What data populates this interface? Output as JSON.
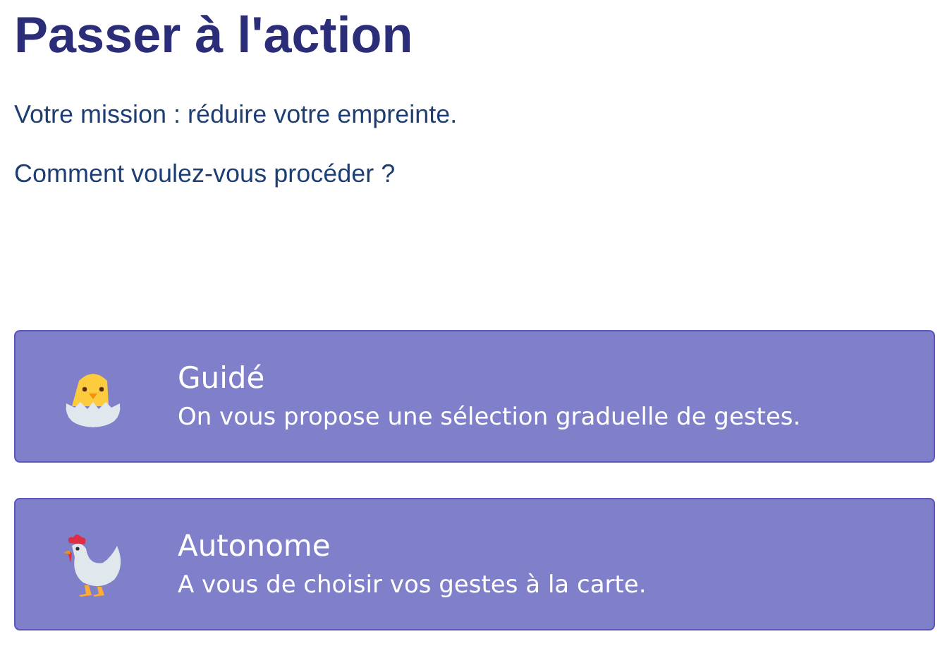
{
  "title": "Passer à l'action",
  "paragraphs": [
    "Votre mission : réduire votre empreinte.",
    "Comment voulez-vous procéder ?"
  ],
  "options": [
    {
      "kind": "chick",
      "title": "Guidé",
      "description": "On vous propose une sélection graduelle de gestes."
    },
    {
      "kind": "hen",
      "title": "Autonome",
      "description": "A vous de choisir vos gestes à la carte."
    }
  ]
}
